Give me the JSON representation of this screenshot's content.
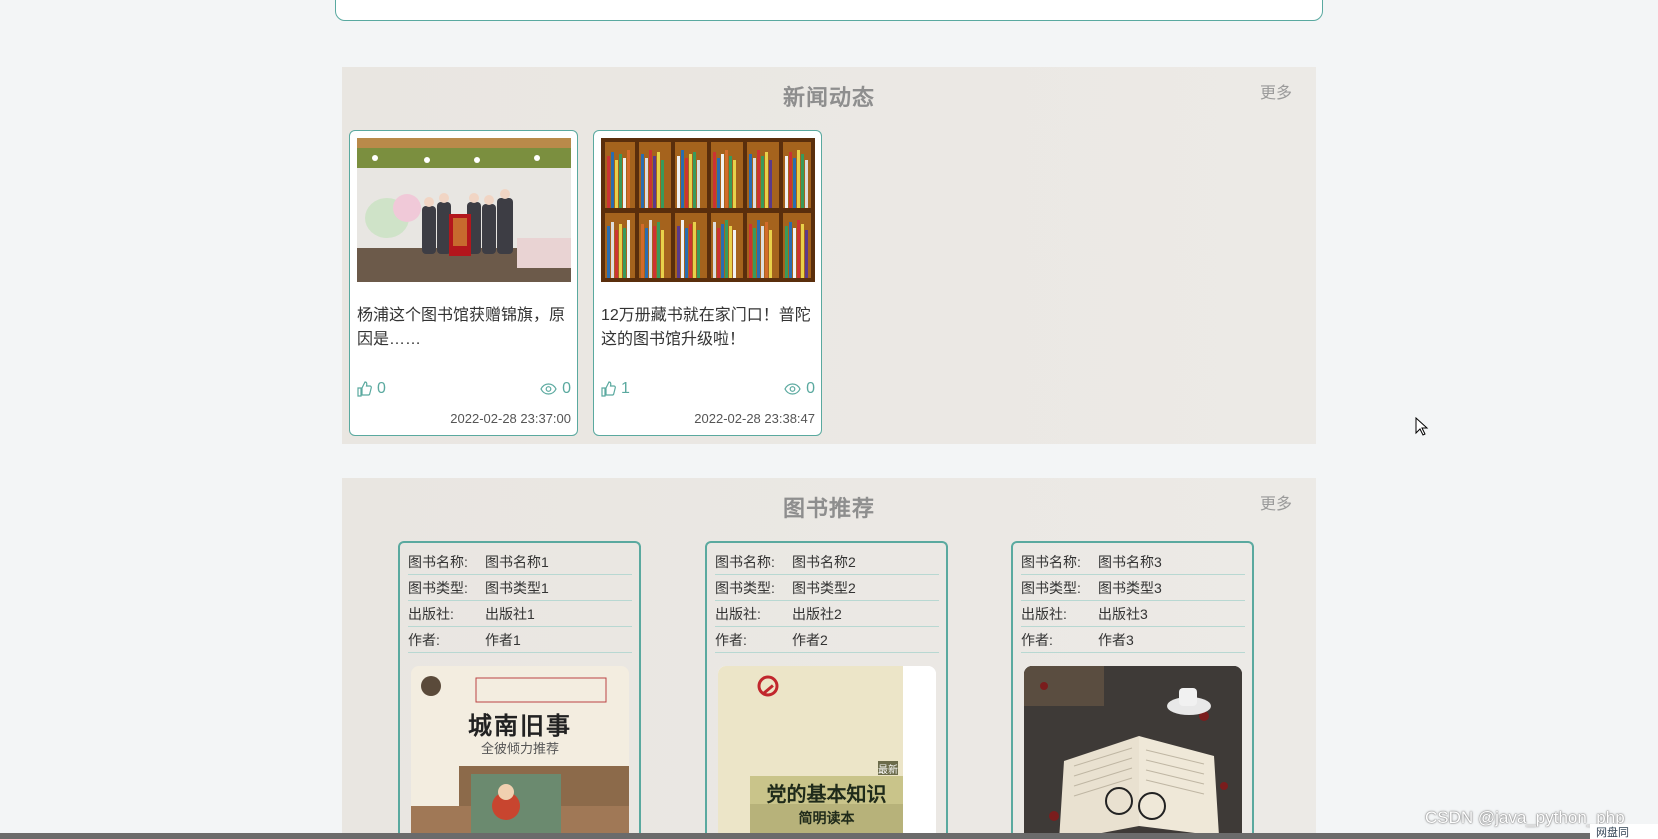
{
  "news": {
    "title": "新闻动态",
    "more": "更多",
    "items": [
      {
        "title": "杨浦这个图书馆获赠锦旗，原因是……",
        "likes": "0",
        "views": "0",
        "date": "2022-02-28 23:37:00"
      },
      {
        "title": "12万册藏书就在家门口！普陀这的图书馆升级啦！",
        "likes": "1",
        "views": "0",
        "date": "2022-02-28 23:38:47"
      }
    ]
  },
  "books": {
    "title": "图书推荐",
    "more": "更多",
    "labels": {
      "name": "图书名称:",
      "type": "图书类型:",
      "publisher": "出版社:",
      "author": "作者:"
    },
    "items": [
      {
        "name": "图书名称1",
        "type": "图书类型1",
        "publisher": "出版社1",
        "author": "作者1",
        "cover_title": "城南旧事",
        "cover_sub": "全彼倾力推荐"
      },
      {
        "name": "图书名称2",
        "type": "图书类型2",
        "publisher": "出版社2",
        "author": "作者2",
        "cover_title": "党的基本知识",
        "cover_sub": "简明读本",
        "cover_badge": "最新"
      },
      {
        "name": "图书名称3",
        "type": "图书类型3",
        "publisher": "出版社3",
        "author": "作者3"
      }
    ]
  },
  "watermark": "CSDN @java_python_php",
  "corner_logo": "网盘同",
  "colors": {
    "accent": "#5aa99f",
    "section_bg": "#e9e6e1",
    "page_bg": "#f3f5f6"
  }
}
